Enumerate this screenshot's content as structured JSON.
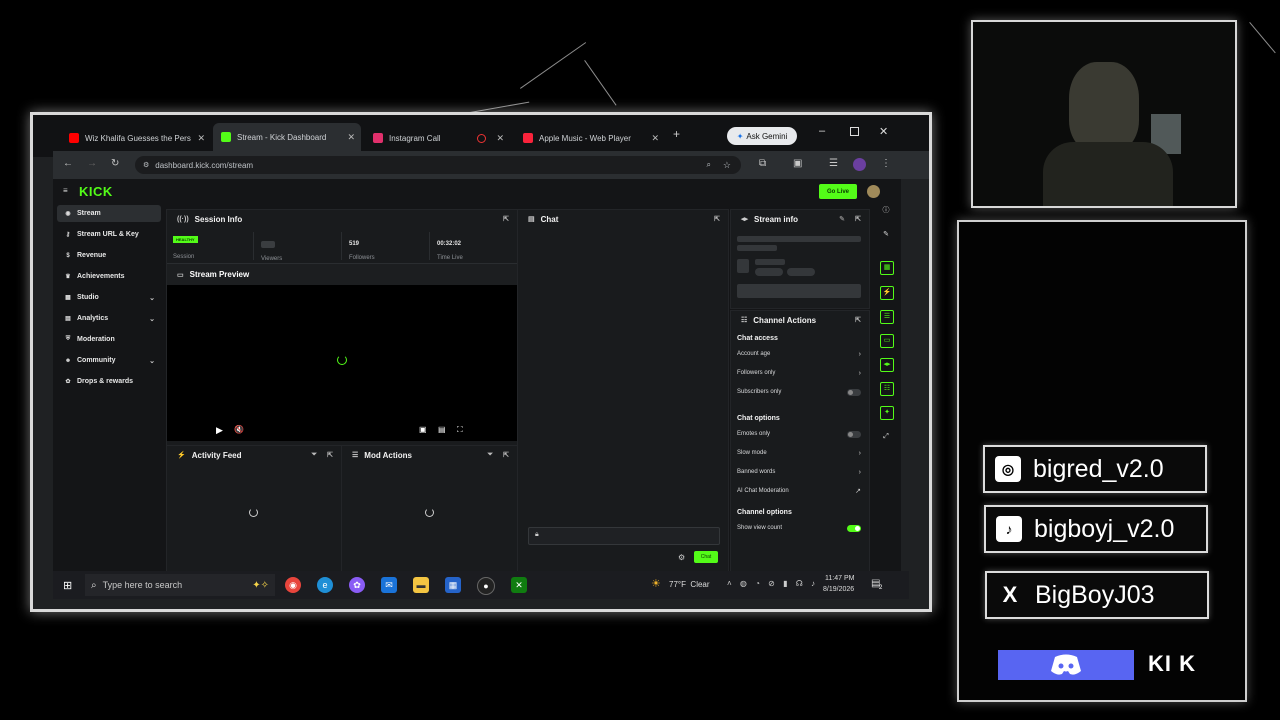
{
  "browser": {
    "tabs": [
      {
        "label": "Wiz Khalifa Guesses the Perso",
        "icon_color": "#ff0000",
        "icon": "youtube-icon"
      },
      {
        "label": "Stream - Kick Dashboard",
        "icon_color": "#53fc18",
        "icon": "kick-icon"
      },
      {
        "label": "Instagram Call",
        "icon_color": "#e1306c",
        "icon": "instagram-icon"
      },
      {
        "label": "Apple Music - Web Player",
        "icon_color": "#fa233b",
        "icon": "music-icon"
      }
    ],
    "new_tab": "+",
    "gemini_label": "Ask Gemini",
    "url": "dashboard.kick.com/stream"
  },
  "kick": {
    "logo": "KICK",
    "go_live": "Go Live",
    "accent": "#53fc18",
    "sidebar": [
      {
        "label": "Stream",
        "icon": "stream-icon",
        "active": true
      },
      {
        "label": "Stream URL & Key",
        "icon": "key-icon"
      },
      {
        "label": "Revenue",
        "icon": "dollar-icon"
      },
      {
        "label": "Achievements",
        "icon": "trophy-icon"
      },
      {
        "label": "Studio",
        "icon": "studio-icon",
        "chevron": "⌄"
      },
      {
        "label": "Analytics",
        "icon": "chart-icon",
        "chevron": "⌄"
      },
      {
        "label": "Moderation",
        "icon": "shield-icon"
      },
      {
        "label": "Community",
        "icon": "people-icon",
        "chevron": "⌄"
      },
      {
        "label": "Drops & rewards",
        "icon": "gift-icon"
      }
    ],
    "session": {
      "title": "Session Info",
      "badge": "HEALTHY",
      "stats": [
        {
          "value": "",
          "label": "Session"
        },
        {
          "value": "",
          "label": "Viewers"
        },
        {
          "value": "519",
          "label": "Followers"
        },
        {
          "value": "00:32:02",
          "label": "Time Live"
        }
      ]
    },
    "preview_title": "Stream Preview",
    "activity_title": "Activity Feed",
    "mod_title": "Mod Actions",
    "chat_title": "Chat",
    "chat_send": "Chat",
    "stream_info_title": "Stream info",
    "channel_actions_title": "Channel Actions",
    "chat_access": {
      "title": "Chat access",
      "items": [
        {
          "label": "Account age",
          "control": "›"
        },
        {
          "label": "Followers only",
          "control": "›"
        },
        {
          "label": "Subscribers only",
          "control": "toggle",
          "on": false
        }
      ]
    },
    "chat_options": {
      "title": "Chat options",
      "items": [
        {
          "label": "Emotes only",
          "control": "toggle",
          "on": false
        },
        {
          "label": "Slow mode",
          "control": "›"
        },
        {
          "label": "Banned words",
          "control": "›"
        },
        {
          "label": "AI Chat Moderation",
          "control": "↗"
        }
      ]
    },
    "channel_options": {
      "title": "Channel options",
      "items": [
        {
          "label": "Show view count",
          "control": "toggle",
          "on": true
        }
      ]
    }
  },
  "taskbar": {
    "search_placeholder": "Type here to search",
    "weather": "77°F  Clear",
    "time": "11:47 PM",
    "date": "8/19/2026",
    "notif_count": "2"
  },
  "socials": [
    {
      "icon": "instagram-icon",
      "glyph": "◎",
      "handle": "bigred_v2.0"
    },
    {
      "icon": "tiktok-icon",
      "glyph": "♪",
      "handle": "bigboyj_v2.0"
    },
    {
      "icon": "x-icon",
      "glyph": "X",
      "handle": "BigBoyJ03"
    }
  ],
  "bottom_logo": "KI K",
  "discord_color": "#5865f2"
}
